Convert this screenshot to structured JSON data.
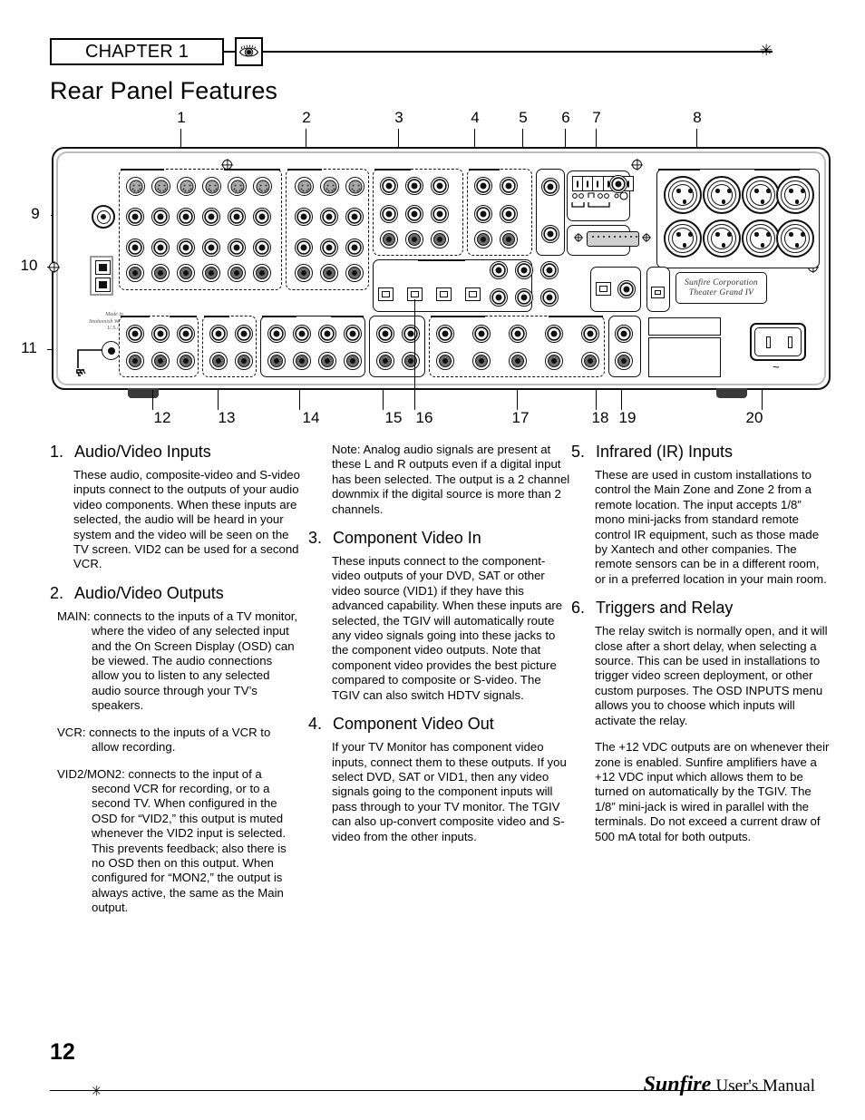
{
  "header": {
    "chapter_label": "CHAPTER 1",
    "eye_icon": "eye-icon",
    "star_icon": "✳",
    "page_title": "Rear Panel Features"
  },
  "diagram": {
    "top_callouts": [
      "1",
      "2",
      "3",
      "4",
      "5",
      "6",
      "7",
      "8"
    ],
    "left_callouts": [
      "9",
      "10",
      "11"
    ],
    "bottom_callouts": [
      "12",
      "13",
      "14",
      "15",
      "16",
      "17",
      "18",
      "19",
      "20"
    ],
    "panel_text": {
      "made_in_line1": "Made in",
      "made_in_line2": "Snohomish Washington",
      "made_in_line3": "U.S.A.",
      "brand_line1": "Sunfire Corporation",
      "brand_line2": "Theater Grand IV",
      "ac_symbol": "~"
    }
  },
  "sections": [
    {
      "number": "1.",
      "title": "Audio/Video Inputs",
      "paragraphs": [
        "These audio, composite-video and S-video inputs connect to the outputs of your audio video components. When these inputs are selected, the audio will be heard in your system and the video will be seen on the TV screen. VID2 can be used for a second VCR."
      ]
    },
    {
      "number": "2.",
      "title": "Audio/Video Outputs",
      "paragraphs": [
        "MAIN: connects to the inputs of a TV monitor, where the video of any selected input and the On Screen Display (OSD) can be viewed. The audio connections allow you to listen to any selected audio source through your TV’s speakers.",
        "VCR: connects to the inputs of a VCR to allow recording.",
        "VID2/MON2: connects to the input of a second VCR for recording, or to a second TV. When configured in the OSD for “VID2,” this output is muted whenever the VID2 input is selected. This prevents feedback; also there is no OSD then on this output. When configured for “MON2,” the output is always active, the same as the Main output."
      ]
    },
    {
      "number": "3.",
      "title": "Component Video In",
      "paragraphs": [
        "These inputs connect to the component-video outputs of your DVD, SAT or other video source (VID1) if they have this advanced capability. When these inputs are selected, the TGIV will automatically route any video signals going into these jacks to the component video outputs. Note that component video provides the best picture compared to composite or S-video. The TGIV can also switch HDTV signals."
      ]
    },
    {
      "number": "4.",
      "title": "Component Video Out",
      "paragraphs": [
        "If your TV Monitor has component video inputs, connect them to these outputs. If you select DVD, SAT or VID1, then any video signals going to the component inputs will pass through to your TV monitor. The TGIV can also up-convert composite video and S-video from the other inputs."
      ]
    },
    {
      "number": "5.",
      "title": "Infrared (IR) Inputs",
      "paragraphs": [
        "These are used in custom installations to control the Main Zone and Zone 2 from a remote location. The input accepts 1/8” mono mini-jacks from standard remote control IR equipment, such as those made by Xantech and other companies. The remote sensors can be in a different room, or in a preferred location in your main room."
      ]
    },
    {
      "number": "6.",
      "title": "Triggers and Relay",
      "paragraphs": [
        "The relay switch is normally open, and it will close after a short delay, when selecting a source. This can be used in installations to trigger video screen deployment, or other custom purposes. The OSD INPUTS menu allows you to choose which inputs will activate the relay.",
        "The +12 VDC outputs are on whenever their zone is enabled. Sunfire amplifiers have a +12 VDC input which allows them to be turned on automatically by the TGIV. The 1/8” mini-jack is wired in parallel with the terminals. Do not exceed a current draw of 500 mA total for both outputs."
      ]
    }
  ],
  "note": {
    "text": "Note: Analog audio signals are present at these L and R outputs even if a digital input has been selected. The output is a 2 channel downmix if the digital source is more than 2 channels."
  },
  "footer": {
    "page_number": "12",
    "star_icon": "✳",
    "brand": "Sunfire",
    "manual": "User's Manual"
  }
}
